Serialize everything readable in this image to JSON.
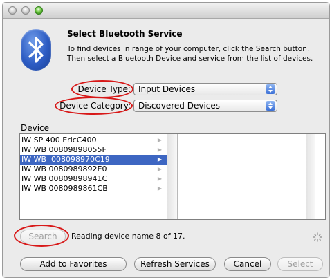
{
  "dialog": {
    "title": "Select Bluetooth Service",
    "description": "To find devices in range of your computer, click the Search button. Then select a Bluetooth Device and service from the list of devices."
  },
  "device_type": {
    "label": "Device Type:",
    "value": "Input Devices"
  },
  "device_category": {
    "label": "Device Category:",
    "value": "Discovered Devices"
  },
  "device_list": {
    "label": "Device",
    "items": [
      "IW SP 400 EricC400",
      "IW WB 00809898055F",
      "IW WB  008098970C19",
      "IW WB 0080989892E0",
      "IW WB 00809898941C",
      "IW WB 0080989861CB"
    ],
    "selected_index": 2
  },
  "search": {
    "button_label": "Search",
    "status": "Reading device name 8 of 17."
  },
  "buttons": {
    "add_favorites": "Add to Favorites",
    "refresh": "Refresh Services",
    "cancel": "Cancel",
    "select": "Select"
  },
  "colors": {
    "selection": "#3d66c2",
    "annotation_ring": "#d81818",
    "bluetooth_blue": "#2d5cc4"
  },
  "icons": [
    "bluetooth-icon",
    "popup-arrows-icon",
    "chevron-right-icon",
    "spinner-icon"
  ]
}
